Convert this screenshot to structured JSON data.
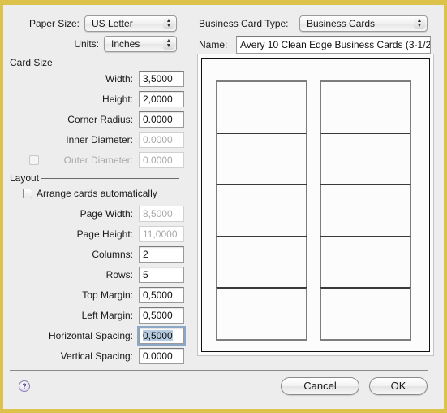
{
  "paper_size": {
    "label": "Paper Size:",
    "value": "US Letter"
  },
  "units": {
    "label": "Units:",
    "value": "Inches"
  },
  "business_card_type": {
    "label": "Business Card Type:",
    "value": "Business Cards"
  },
  "name": {
    "label": "Name:",
    "value": "Avery 10 Clean Edge Business Cards (3-1/2"
  },
  "card_size": {
    "title": "Card Size",
    "width": {
      "label": "Width:",
      "value": "3,5000"
    },
    "height": {
      "label": "Height:",
      "value": "2,0000"
    },
    "corner_radius": {
      "label": "Corner Radius:",
      "value": "0.0000"
    },
    "inner_diameter": {
      "label": "Inner Diameter:",
      "value": "0.0000",
      "enabled": false
    },
    "outer_diameter": {
      "label": "Outer Diameter:",
      "value": "0.0000",
      "enabled": false,
      "checked": false
    }
  },
  "layout": {
    "title": "Layout",
    "arrange_automatically": {
      "label": "Arrange cards automatically",
      "checked": false
    },
    "page_width": {
      "label": "Page Width:",
      "value": "8,5000",
      "enabled": false
    },
    "page_height": {
      "label": "Page Height:",
      "value": "11,0000",
      "enabled": false
    },
    "columns": {
      "label": "Columns:",
      "value": "2"
    },
    "rows": {
      "label": "Rows:",
      "value": "5"
    },
    "top_margin": {
      "label": "Top Margin:",
      "value": "0,5000"
    },
    "left_margin": {
      "label": "Left Margin:",
      "value": "0,5000"
    },
    "horizontal_spacing": {
      "label": "Horizontal Spacing:",
      "value": "0,5000",
      "focused": true
    },
    "vertical_spacing": {
      "label": "Vertical Spacing:",
      "value": "0.0000"
    }
  },
  "preview": {
    "columns": 2,
    "rows": 5
  },
  "footer": {
    "help_icon": "?",
    "cancel_label": "Cancel",
    "ok_label": "OK"
  },
  "colors": {
    "window_border": "#dcc24a",
    "focus_ring": "#8da7c7"
  }
}
